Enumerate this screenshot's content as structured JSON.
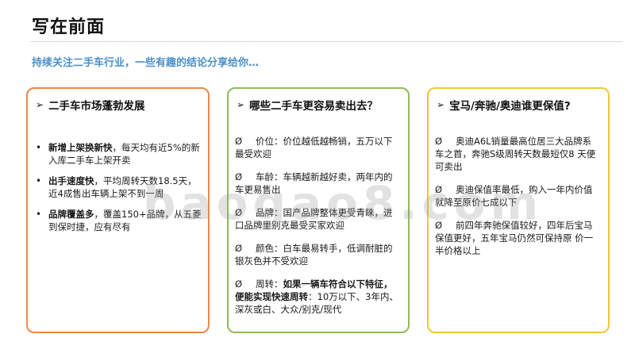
{
  "title": "写在前面",
  "subtitle": "持续关注二手车行业，一些有趣的结论分享给你…",
  "watermark": "baogao8.com",
  "colors": {
    "orange": "#e8894a",
    "green": "#8fba5a",
    "yellow": "#f1c737",
    "accent_blue": "#4a90c8"
  },
  "cards": [
    {
      "heading": "二手车市场蓬勃发展",
      "items": [
        {
          "bold": "新增上架换新快",
          "text": "，每天均有近5%的新入库二手车上架开卖"
        },
        {
          "bold": "出手速度快",
          "text": "，平均周转天数18.5天，近4成售出车辆上架不到一周"
        },
        {
          "bold": "品牌覆盖多",
          "text": "，覆盖150+品牌，从五菱到保时捷，应有尽有"
        }
      ]
    },
    {
      "heading": "哪些二手车更容易卖出去？",
      "items": [
        {
          "symbol": "Ø",
          "text": "价位：价位越低越畅销，五万以下最受欢迎"
        },
        {
          "symbol": "Ø",
          "text": "车龄：车辆越新越好卖，两年内的车更易售出"
        },
        {
          "symbol": "Ø",
          "text": "品牌：国产品牌整体更受青睐，进口品牌里别克最受买家欢迎"
        },
        {
          "symbol": "Ø",
          "text": "颜色：白车最易转手，低调耐脏的银灰色并不受欢迎"
        },
        {
          "symbol": "Ø",
          "prefix": "周转：",
          "bold": "如果一辆车符合以下特征，便能实现快速周转",
          "text": "：10万以下、3年内、深灰或白、大众/别克/现代"
        }
      ]
    },
    {
      "heading": "宝马/奔驰/奥迪谁更保值?",
      "items": [
        {
          "symbol": "Ø",
          "text": "奥迪A6L销量最高位居三大品牌系车之首，奔驰S级周转天数最短仅8 天便可卖出"
        },
        {
          "symbol": "Ø",
          "text": "奥迪保值率最低，购入一年内价值就降至原价七成以下"
        },
        {
          "symbol": "Ø",
          "text": "前四年奔驰保值较好，四年后宝马保值更好，五年宝马仍然可保持原 价一半价格以上"
        }
      ]
    }
  ]
}
